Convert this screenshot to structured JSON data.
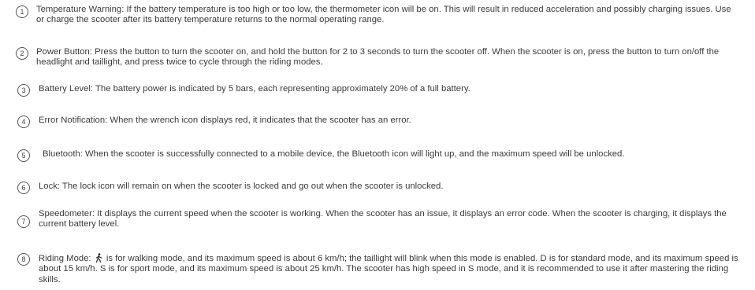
{
  "items": [
    {
      "number": "1",
      "text": "Temperature Warning: If the battery temperature is too high or too low, the thermometer icon will be on. This will result in reduced acceleration and possibly charging issues. Use or charge the scooter after its battery temperature returns to the normal operating range."
    },
    {
      "number": "2",
      "text": "Power Button: Press the button to turn the scooter on, and hold the button for 2 to 3 seconds to turn the scooter off. When the scooter is on, press the button to turn on/off the headlight and taillight, and press twice to cycle through the riding modes."
    },
    {
      "number": "3",
      "text": "Battery Level: The battery power is indicated by 5 bars, each representing approximately 20% of a full battery."
    },
    {
      "number": "4",
      "text": "Error Notification: When the wrench icon displays red, it indicates that the scooter has an error."
    },
    {
      "number": "5",
      "text": "Bluetooth: When the scooter is successfully connected to a mobile device, the Bluetooth icon will light up, and the maximum speed will be unlocked."
    },
    {
      "number": "6",
      "text": "Lock: The lock icon will remain on when the scooter is locked and go out when the scooter is unlocked."
    },
    {
      "number": "7",
      "text": "Speedometer: It displays the current speed when the scooter is working. When the scooter has an issue, it displays an error code. When the scooter is charging, it displays the current battery level."
    },
    {
      "number": "8",
      "text_before_icon": "Riding Mode:",
      "icon": "walking-person-icon",
      "text_after_icon": "is for walking mode, and its maximum speed is about 6 km/h; the taillight will blink when this mode is enabled. D is for standard mode, and its maximum speed is about 15 km/h. S is for sport mode, and its maximum speed is about 25 km/h. The scooter has high speed in S mode, and it is recommended to use it after mastering the riding skills."
    }
  ]
}
